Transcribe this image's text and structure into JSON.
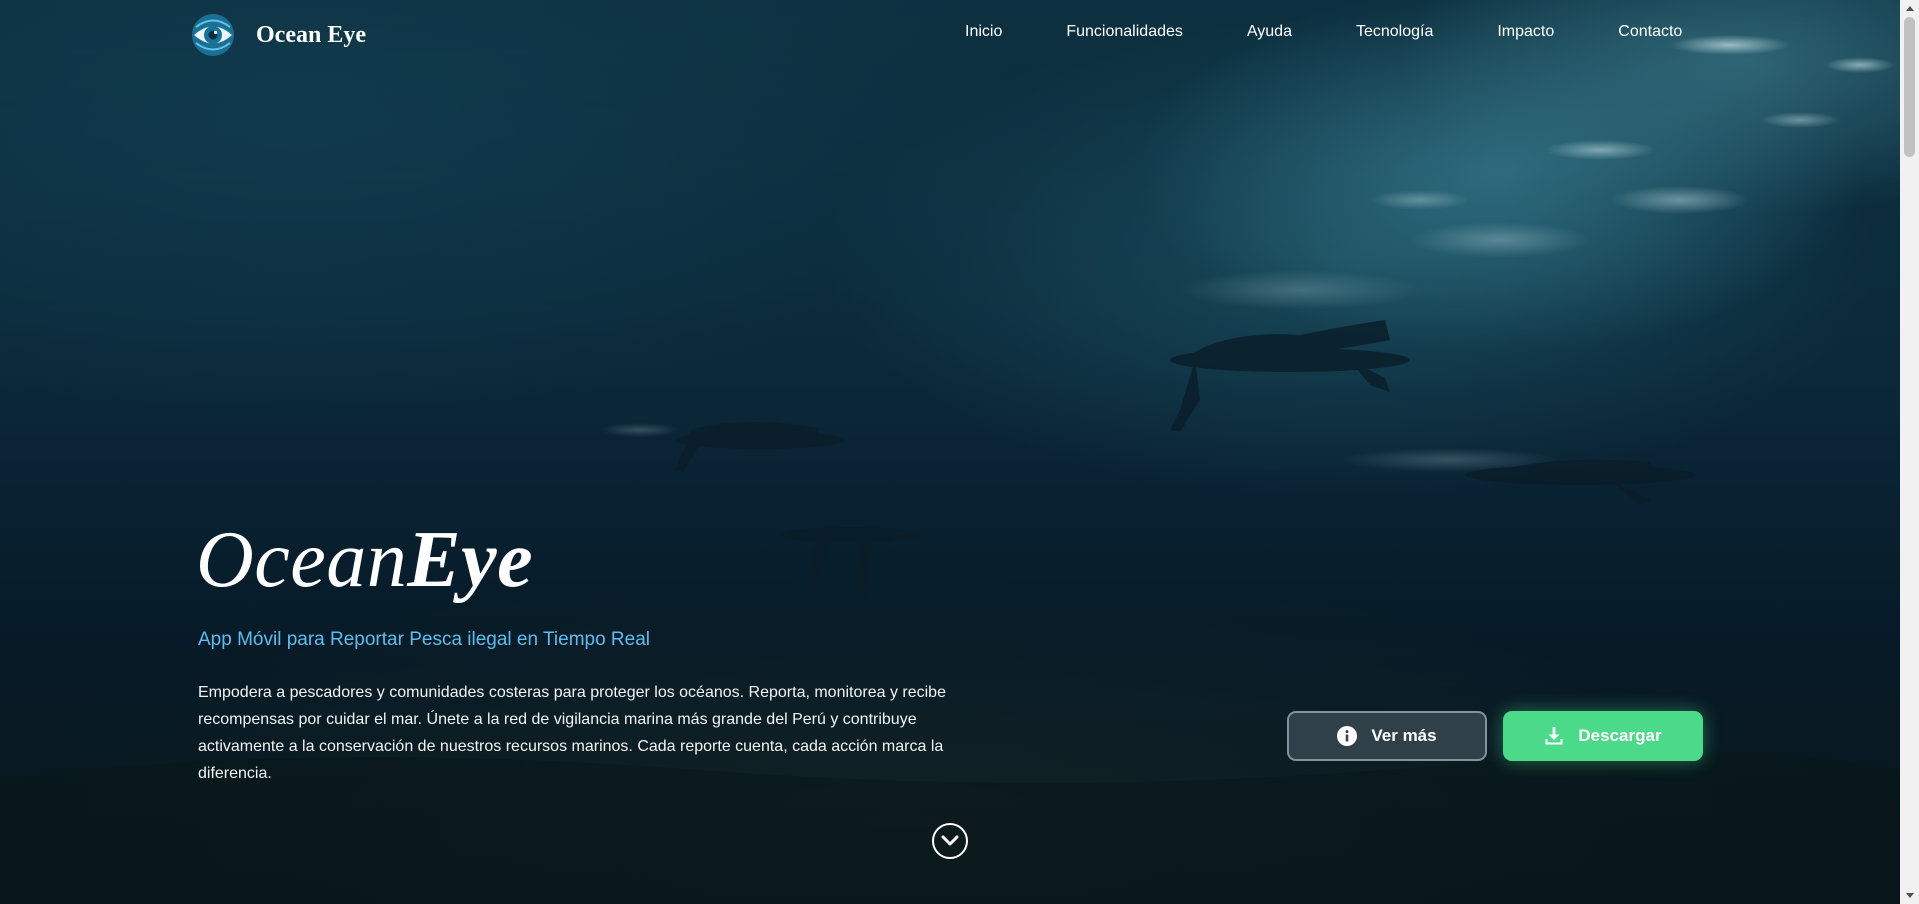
{
  "brand": {
    "name": "Ocean Eye",
    "logo_icon": "eye-logo-icon"
  },
  "nav": {
    "links": [
      "Inicio",
      "Funcionalidades",
      "Ayuda",
      "Tecnología",
      "Impacto",
      "Contacto"
    ]
  },
  "hero": {
    "headline_light": "Ocean",
    "headline_bold": "Eye",
    "tagline": "App Móvil para Reportar Pesca ilegal en Tiempo Real",
    "description": "Empodera a pescadores y comunidades costeras para proteger los océanos. Reporta, monitorea y recibe recompensas por cuidar el mar. Únete a la red de vigilancia marina más grande del Perú y contribuye activamente a la conservación de nuestros recursos marinos. Cada reporte cuenta, cada acción marca la diferencia."
  },
  "buttons": {
    "more_label": "Ver más",
    "more_icon": "info-icon",
    "download_label": "Descargar",
    "download_icon": "download-icon"
  },
  "scroll_indicator_icon": "chevron-down-icon",
  "colors": {
    "tagline": "#5bbef0",
    "download_button": "#4bd98a",
    "more_button": "#37464f"
  }
}
